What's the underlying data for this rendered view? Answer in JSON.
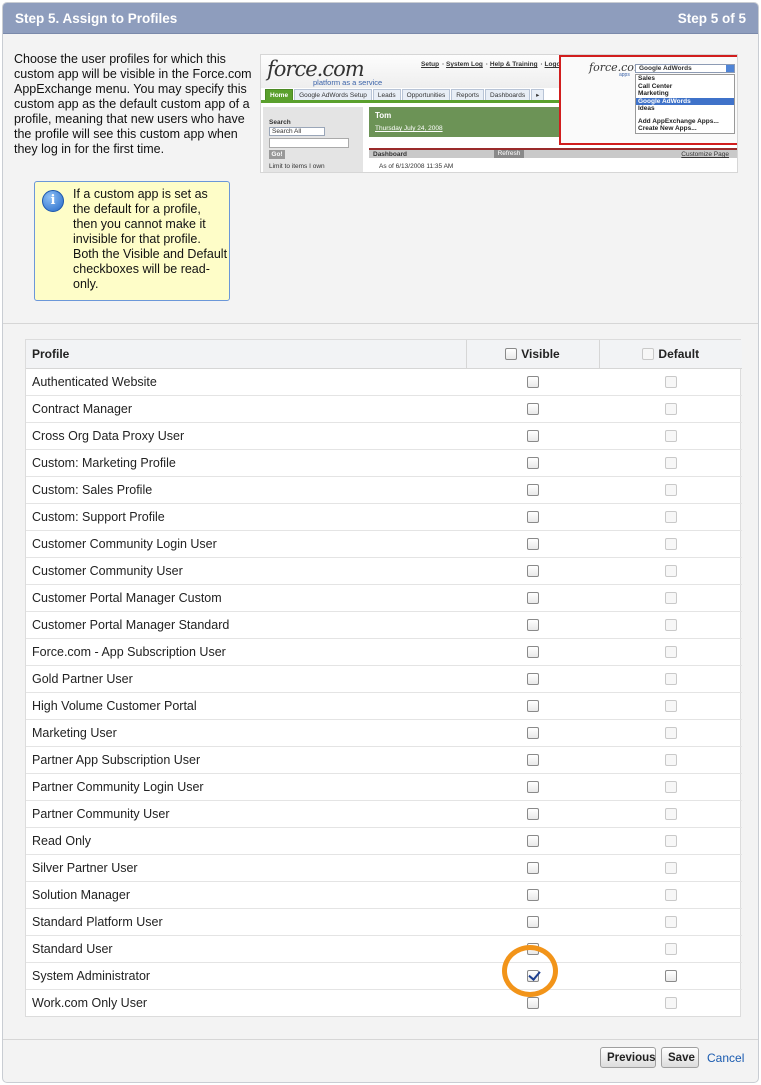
{
  "header": {
    "title": "Step 5. Assign to Profiles",
    "step_count": "Step 5 of 5"
  },
  "intro_text": "Choose the user profiles for which this custom app will be visible in the Force.com AppExchange menu. You may specify this custom app as the default custom app of a profile, meaning that new users who have the profile will see this custom app when they log in for the first time.",
  "info_box": {
    "icon": "info-icon",
    "text": "If a custom app is set as the default for a profile, then you cannot make it invisible for that profile. Both the Visible and Default checkboxes will be read-only."
  },
  "preview": {
    "logo": "force.com",
    "logo_sub": "platform as a service",
    "links": [
      "Setup",
      "System Log",
      "Help & Training",
      "Logout"
    ],
    "tabs": [
      "Home",
      "Google AdWords Setup",
      "Leads",
      "Opportunities",
      "Reports",
      "Dashboards",
      "▸"
    ],
    "search_label": "Search",
    "search_select": "Search All",
    "go_button": "Go!",
    "limit_text": "Limit to items I own",
    "user_name": "Tom",
    "date": "Thursday July 24, 2008",
    "dashboard_label": "Dashboard",
    "refresh_button": "Refresh",
    "customize_link": "Customize Page",
    "as_of": "As of 6/13/2008 11:35 AM",
    "app_logo": "force.com",
    "app_logo_sub": "apps",
    "app_selected": "Google AdWords",
    "app_menu": [
      "Sales",
      "Call Center",
      "Marketing",
      "Google AdWords",
      "Ideas",
      "",
      "Add AppExchange Apps...",
      "Create New Apps..."
    ]
  },
  "table": {
    "col_profile": "Profile",
    "col_visible": "Visible",
    "col_default": "Default",
    "rows": [
      {
        "name": "Authenticated Website",
        "visible": false,
        "default": false
      },
      {
        "name": "Contract Manager",
        "visible": false,
        "default": false
      },
      {
        "name": "Cross Org Data Proxy User",
        "visible": false,
        "default": false
      },
      {
        "name": "Custom: Marketing Profile",
        "visible": false,
        "default": false
      },
      {
        "name": "Custom: Sales Profile",
        "visible": false,
        "default": false
      },
      {
        "name": "Custom: Support Profile",
        "visible": false,
        "default": false
      },
      {
        "name": "Customer Community Login User",
        "visible": false,
        "default": false
      },
      {
        "name": "Customer Community User",
        "visible": false,
        "default": false
      },
      {
        "name": "Customer Portal Manager Custom",
        "visible": false,
        "default": false
      },
      {
        "name": "Customer Portal Manager Standard",
        "visible": false,
        "default": false
      },
      {
        "name": "Force.com - App Subscription User",
        "visible": false,
        "default": false
      },
      {
        "name": "Gold Partner User",
        "visible": false,
        "default": false
      },
      {
        "name": "High Volume Customer Portal",
        "visible": false,
        "default": false
      },
      {
        "name": "Marketing User",
        "visible": false,
        "default": false
      },
      {
        "name": "Partner App Subscription User",
        "visible": false,
        "default": false
      },
      {
        "name": "Partner Community Login User",
        "visible": false,
        "default": false
      },
      {
        "name": "Partner Community User",
        "visible": false,
        "default": false
      },
      {
        "name": "Read Only",
        "visible": false,
        "default": false
      },
      {
        "name": "Silver Partner User",
        "visible": false,
        "default": false
      },
      {
        "name": "Solution Manager",
        "visible": false,
        "default": false
      },
      {
        "name": "Standard Platform User",
        "visible": false,
        "default": false
      },
      {
        "name": "Standard User",
        "visible": false,
        "default": false
      },
      {
        "name": "System Administrator",
        "visible": true,
        "default": false
      },
      {
        "name": "Work.com Only User",
        "visible": false,
        "default": false
      }
    ]
  },
  "buttons": {
    "previous": "Previous",
    "save": "Save",
    "cancel": "Cancel"
  },
  "colors": {
    "header_bg": "#8e9dbd",
    "highlight_ring": "#f29419",
    "info_bg": "#fefdc8",
    "link": "#1a5bb0"
  }
}
